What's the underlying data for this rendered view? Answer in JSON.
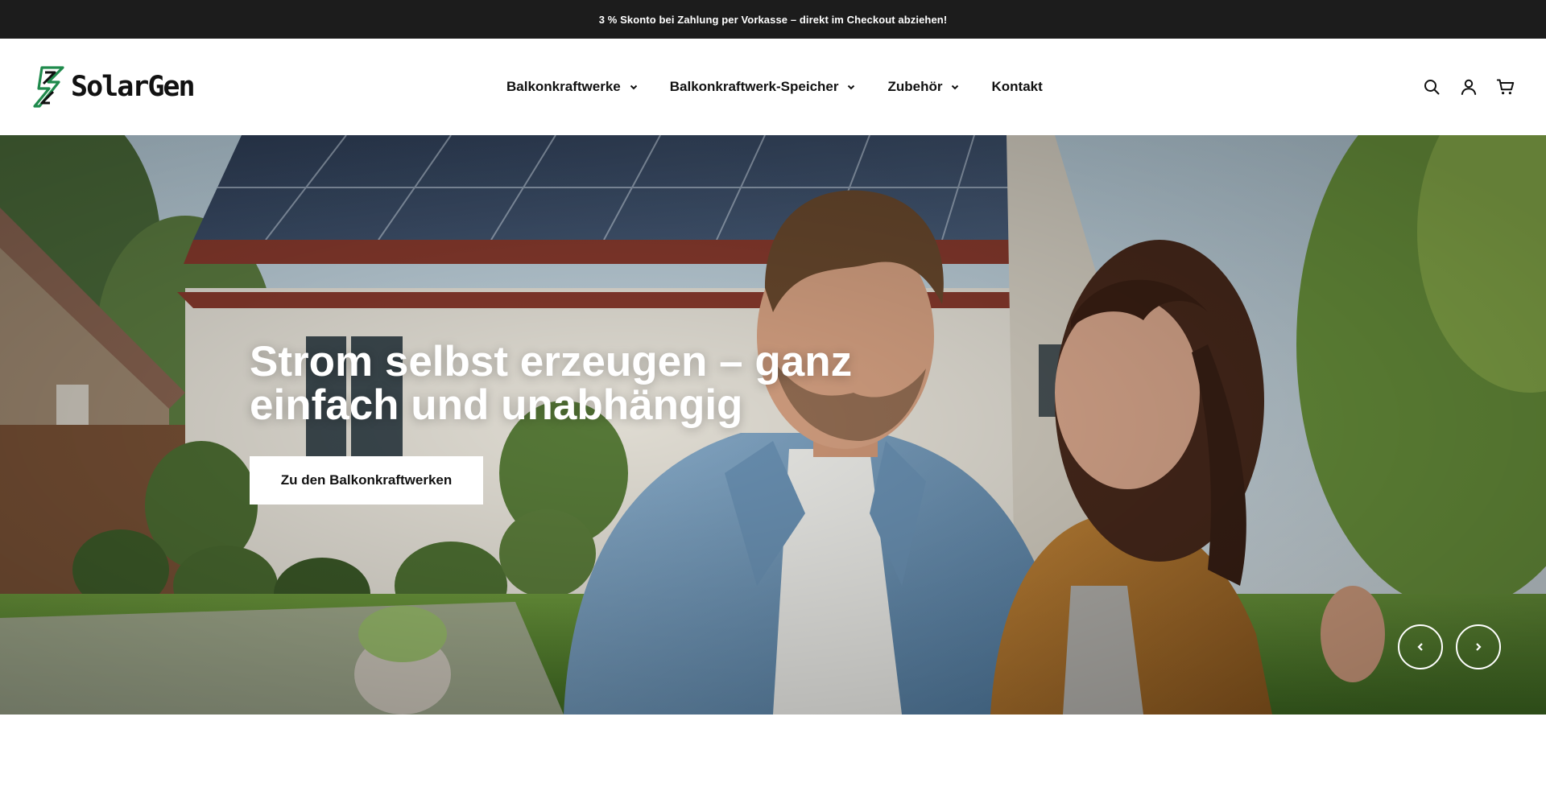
{
  "announcement": {
    "text": "3 % Skonto bei Zahlung per Vorkasse – direkt im Checkout abziehen!"
  },
  "header": {
    "logo_text": "SolarGen",
    "nav": [
      {
        "label": "Balkonkraftwerke",
        "has_dropdown": true
      },
      {
        "label": "Balkonkraftwerk-Speicher",
        "has_dropdown": true
      },
      {
        "label": "Zubehör",
        "has_dropdown": true
      },
      {
        "label": "Kontakt",
        "has_dropdown": false
      }
    ],
    "icons": [
      "search-icon",
      "account-icon",
      "cart-icon"
    ]
  },
  "hero": {
    "title": "Strom selbst erzeugen – ganz einfach und unabhängig",
    "cta_label": "Zu den Balkonkraftwerken",
    "controls": [
      "chevron-left-icon",
      "chevron-right-icon"
    ]
  },
  "colors": {
    "announcement_bg": "#1c1c1c",
    "brand_green": "#1f8a4c",
    "text": "#111111",
    "cta_bg": "#ffffff"
  }
}
